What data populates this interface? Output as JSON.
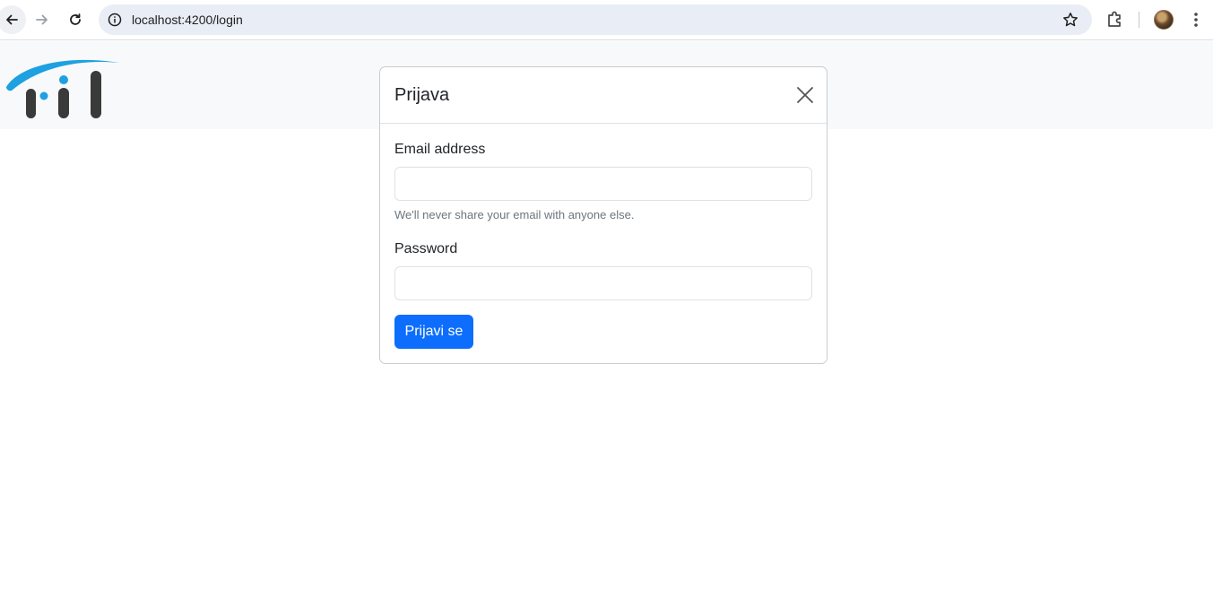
{
  "browser": {
    "url": "localhost:4200/login"
  },
  "modal": {
    "title": "Prijava",
    "email_label": "Email address",
    "email_value": "",
    "email_help": "We'll never share your email with anyone else.",
    "password_label": "Password",
    "password_value": "",
    "submit_label": "Prijavi se"
  },
  "colors": {
    "primary": "#0d6efd",
    "logo_blue": "#1da1e0",
    "logo_dark": "#3a3a3a",
    "navbar_bg": "#f8f9fa"
  },
  "icons": {
    "back": "arrow-left-icon",
    "forward": "arrow-right-icon",
    "reload": "reload-icon",
    "site_info": "info-icon",
    "bookmark": "star-icon",
    "extensions": "puzzle-icon",
    "menu": "more-vertical-icon",
    "close": "close-icon"
  }
}
